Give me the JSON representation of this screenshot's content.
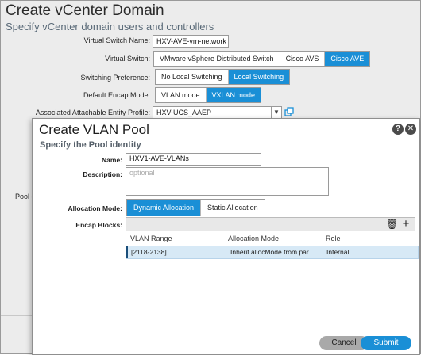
{
  "vcenter": {
    "title": "Create vCenter Domain",
    "subtitle": "Specify vCenter domain users and controllers",
    "virtual_switch_name_label": "Virtual Switch Name:",
    "virtual_switch_name_value": "HXV-AVE-vm-network",
    "virtual_switch_label": "Virtual Switch:",
    "virtual_switch_options": [
      "VMware vSphere Distributed Switch",
      "Cisco AVS",
      "Cisco AVE"
    ],
    "virtual_switch_selected": "Cisco AVE",
    "switching_pref_label": "Switching Preference:",
    "switching_pref_options": [
      "No Local Switching",
      "Local Switching"
    ],
    "switching_pref_selected": "Local Switching",
    "encap_mode_label": "Default Encap Mode:",
    "encap_mode_options": [
      "VLAN mode",
      "VXLAN mode"
    ],
    "encap_mode_selected": "VXLAN mode",
    "aaep_label": "Associated Attachable Entity Profile:",
    "aaep_value": "HXV-UCS_AAEP",
    "pool_label_partial": "Pool c"
  },
  "vlan_pool": {
    "title": "Create VLAN Pool",
    "subtitle": "Specify the Pool identity",
    "name_label": "Name:",
    "name_value": "HXV1-AVE-VLANs",
    "description_label": "Description:",
    "description_placeholder": "optional",
    "allocation_mode_label": "Allocation Mode:",
    "allocation_mode_options": [
      "Dynamic Allocation",
      "Static Allocation"
    ],
    "allocation_mode_selected": "Dynamic Allocation",
    "encap_blocks_label": "Encap Blocks:",
    "columns": [
      "VLAN Range",
      "Allocation Mode",
      "Role"
    ],
    "rows": [
      {
        "range": "[2118-2138]",
        "mode": "Inherit allocMode from par...",
        "role": "Internal"
      }
    ],
    "help_icon_glyph": "?",
    "close_icon_glyph": "✕",
    "delete_icon_glyph": "🗑",
    "add_icon_glyph": "+",
    "cancel_label": "Cancel",
    "submit_label": "Submit"
  },
  "colors": {
    "accent": "#1a8fd6",
    "selected_row": "#d7e9f6"
  }
}
